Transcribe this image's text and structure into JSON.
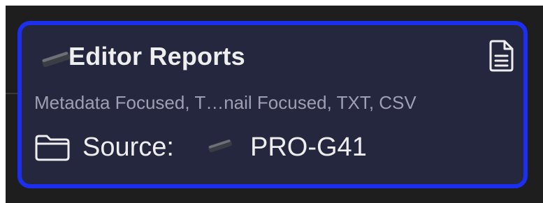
{
  "card": {
    "title": "Editor Reports",
    "subtitle": "Metadata Focused, T…nail Focused, TXT, CSV",
    "source_label": "Source:",
    "source_value": "PRO-G41",
    "title_icon": "drive-icon",
    "report_icon": "document-icon",
    "folder_icon": "folder-icon",
    "source_icon": "drive-icon"
  },
  "colors": {
    "card_background": "#25273f",
    "selection_border": "#1c2ff0",
    "text_primary": "#eeeeee",
    "text_secondary": "#9e9fb3"
  }
}
